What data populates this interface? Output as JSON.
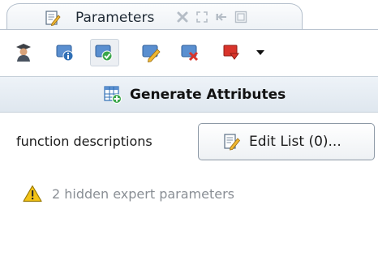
{
  "tab": {
    "title": "Parameters",
    "icon": "parameters-edit-icon",
    "controls": [
      "close-icon",
      "maximize-icon",
      "restore-icon",
      "minimize-icon"
    ]
  },
  "toolbar": {
    "buttons": [
      {
        "name": "expert-mode-icon"
      },
      {
        "name": "show-help-icon"
      },
      {
        "name": "check-parameters-icon",
        "active": true
      },
      {
        "name": "edit-icon"
      },
      {
        "name": "remove-icon"
      },
      {
        "name": "more-actions-icon"
      }
    ]
  },
  "operator": {
    "label": "Generate Attributes",
    "icon": "generate-attributes-icon"
  },
  "parameters": [
    {
      "label": "function descriptions",
      "button_label": "Edit List (0)..."
    }
  ],
  "hidden_note": {
    "text": "2 hidden expert parameters",
    "icon": "warning-icon"
  },
  "colors": {
    "accent_blue": "#2f6fb5",
    "check_green": "#3aa64a",
    "remove_red": "#d9342b",
    "warning_yellow": "#f3c316"
  }
}
